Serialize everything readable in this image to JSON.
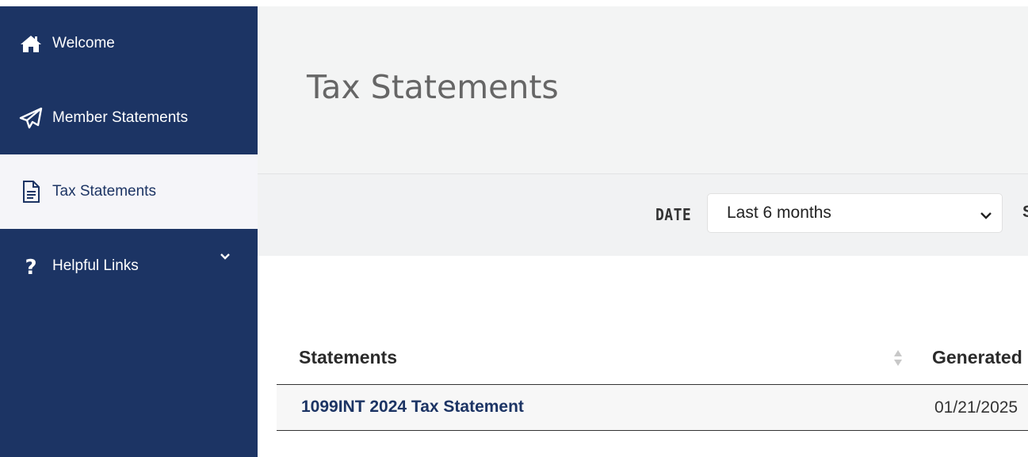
{
  "sidebar": {
    "items": [
      {
        "label": "Welcome",
        "icon": "home-icon"
      },
      {
        "label": "Member Statements",
        "icon": "paper-plane-icon"
      },
      {
        "label": "Tax Statements",
        "icon": "document-icon",
        "active": true
      },
      {
        "label": "Helpful Links",
        "icon": "question-icon",
        "expandable": true
      }
    ]
  },
  "header": {
    "title": "Tax Statements"
  },
  "filters": {
    "date_label": "DATE",
    "date_value": "Last 6 months",
    "next_label_fragment": "S"
  },
  "table": {
    "columns": [
      "Statements",
      "Generated"
    ],
    "rows": [
      {
        "statement": "1099INT 2024 Tax Statement",
        "generated": "01/21/2025"
      }
    ]
  },
  "colors": {
    "sidebar_bg": "#1c3464",
    "active_item_bg": "#f5f5f9",
    "header_bg": "#f3f4f4",
    "link": "#1c3464"
  }
}
